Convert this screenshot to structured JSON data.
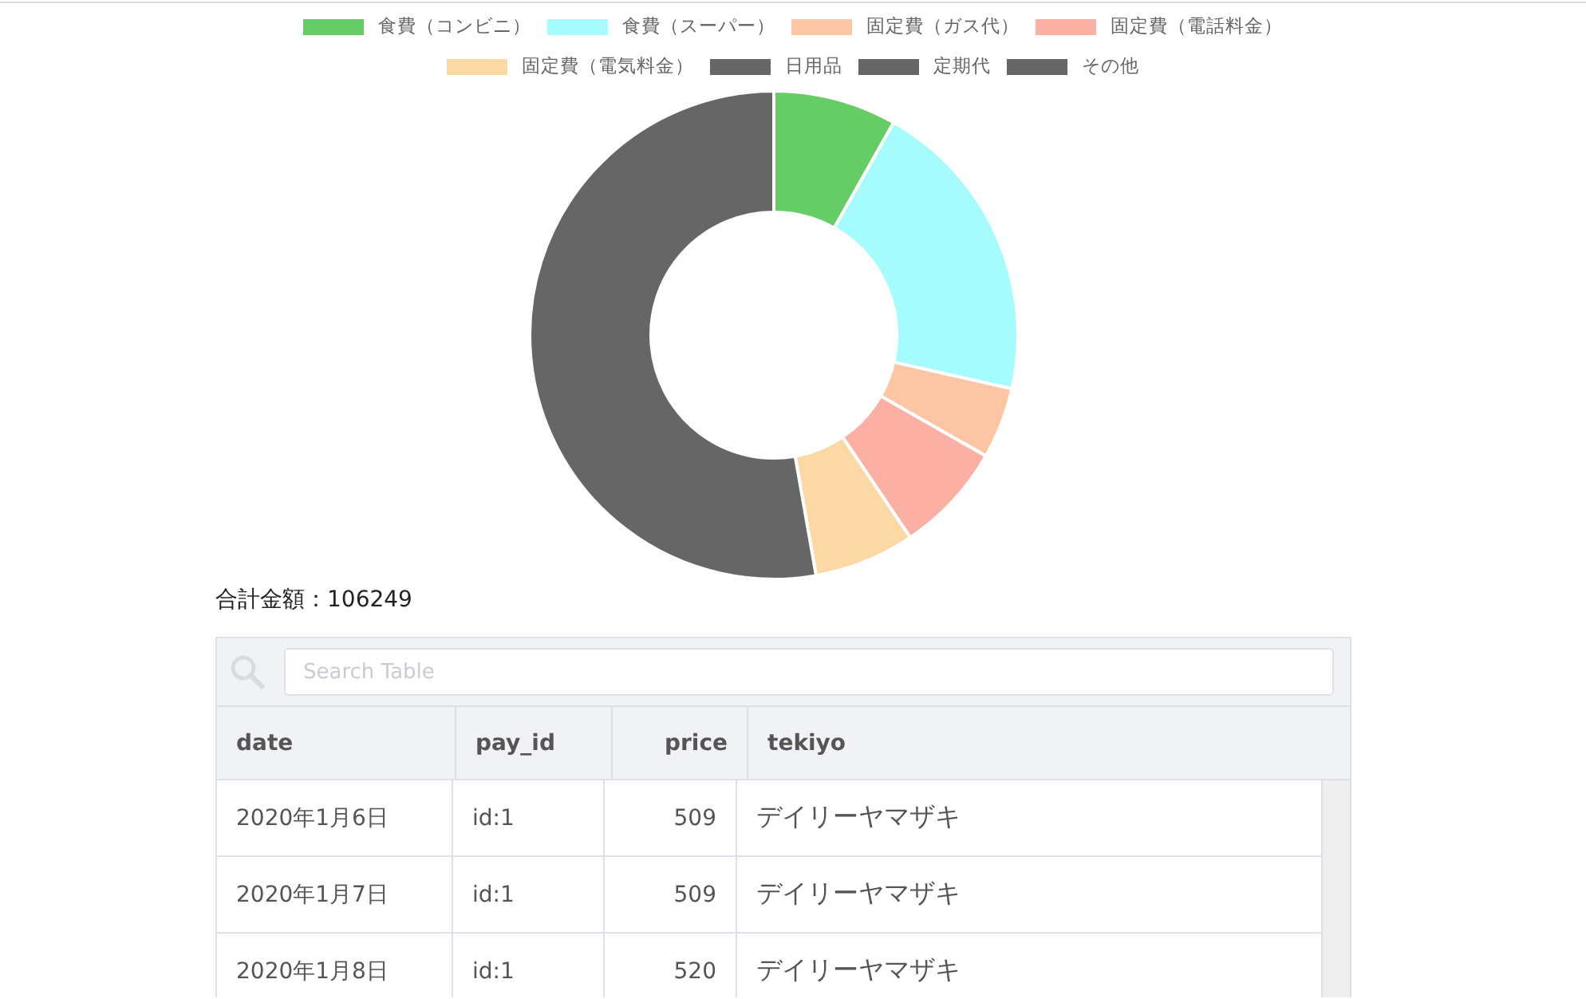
{
  "chart": {
    "slices": [
      {
        "color": "#66cc66"
      },
      {
        "color": "#a6fcfc"
      },
      {
        "color": "#fcc6a4"
      },
      {
        "color": "#fcb0a4"
      },
      {
        "color": "#fcd8a4"
      },
      {
        "color": "#666666"
      },
      {
        "color": "#666666"
      },
      {
        "color": "#666666"
      }
    ],
    "chart_data": {
      "type": "donut",
      "categories": [
        "食費（コンビニ）",
        "食費（スーパー）",
        "固定費（ガス代）",
        "固定費（電話料金）",
        "固定費（電気料金）",
        "日用品",
        "定期代",
        "その他"
      ],
      "values": [
        8.17,
        20.36,
        4.72,
        7.31,
        6.67,
        0,
        0,
        52.77
      ]
    }
  },
  "total": "合計金額：106249",
  "table": {
    "search": {
      "placeholder": "Search Table"
    },
    "columns": [
      {
        "label": "date",
        "numeric": false
      },
      {
        "label": "pay_id",
        "numeric": false
      },
      {
        "label": "price",
        "numeric": true
      },
      {
        "label": "tekiyo",
        "numeric": false
      }
    ],
    "rows": [
      [
        "2020年1月6日",
        "id:1",
        "509",
        "デイリーヤマザキ"
      ],
      [
        "2020年1月7日",
        "id:1",
        "509",
        "デイリーヤマザキ"
      ],
      [
        "2020年1月8日",
        "id:1",
        "520",
        "デイリーヤマザキ"
      ]
    ]
  }
}
